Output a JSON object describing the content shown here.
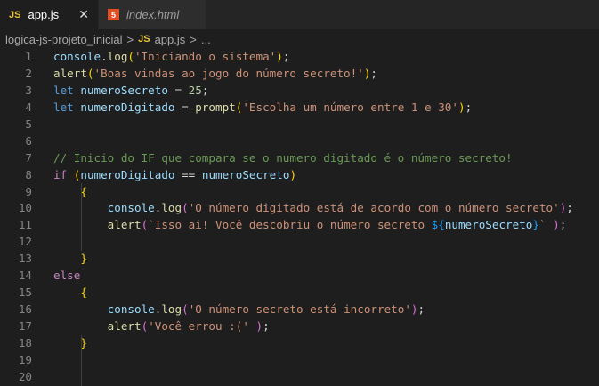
{
  "tabs": [
    {
      "icon": "JS",
      "label": "app.js",
      "close": "✕"
    },
    {
      "icon": "5",
      "label": "index.html"
    }
  ],
  "breadcrumb": {
    "folder": "logica-js-projeto_inicial",
    "sep": ">",
    "icon": "JS",
    "file": "app.js",
    "more": "..."
  },
  "lines": [
    [
      [
        "console",
        "var"
      ],
      [
        ".",
        "p"
      ],
      [
        "log",
        "fn"
      ],
      [
        "(",
        "b1"
      ],
      [
        "'Iniciando o sistema'",
        "str"
      ],
      [
        ")",
        "b1"
      ],
      [
        ";",
        "p"
      ]
    ],
    [
      [
        "alert",
        "fn"
      ],
      [
        "(",
        "b1"
      ],
      [
        "'Boas vindas ao jogo do número secreto!'",
        "str"
      ],
      [
        ")",
        "b1"
      ],
      [
        ";",
        "p"
      ]
    ],
    [
      [
        "let",
        "kw"
      ],
      [
        " ",
        "p"
      ],
      [
        "numeroSecreto",
        "var"
      ],
      [
        " = ",
        "p"
      ],
      [
        "25",
        "num"
      ],
      [
        ";",
        "p"
      ]
    ],
    [
      [
        "let",
        "kw"
      ],
      [
        " ",
        "p"
      ],
      [
        "numeroDigitado",
        "var"
      ],
      [
        " = ",
        "p"
      ],
      [
        "prompt",
        "fn"
      ],
      [
        "(",
        "b1"
      ],
      [
        "'Escolha um número entre 1 e 30'",
        "str"
      ],
      [
        ")",
        "b1"
      ],
      [
        ";",
        "p"
      ]
    ],
    [],
    [],
    [
      [
        "// Inicio do IF que compara se o numero digitado é o número secreto!",
        "cm"
      ]
    ],
    [
      [
        "if",
        "ctl"
      ],
      [
        " ",
        "p"
      ],
      [
        "(",
        "b1"
      ],
      [
        "numeroDigitado",
        "var"
      ],
      [
        " == ",
        "p"
      ],
      [
        "numeroSecreto",
        "var"
      ],
      [
        ")",
        "b1"
      ]
    ],
    [
      [
        "    ",
        "p"
      ],
      [
        "{",
        "b1"
      ]
    ],
    [
      [
        "        ",
        "p"
      ],
      [
        "console",
        "var"
      ],
      [
        ".",
        "p"
      ],
      [
        "log",
        "fn"
      ],
      [
        "(",
        "b2"
      ],
      [
        "'O número digitado está de acordo com o número secreto'",
        "str"
      ],
      [
        ")",
        "b2"
      ],
      [
        ";",
        "p"
      ]
    ],
    [
      [
        "        ",
        "p"
      ],
      [
        "alert",
        "fn"
      ],
      [
        "(",
        "b2"
      ],
      [
        "`Isso ai! Você descobriu o número secreto ",
        "str"
      ],
      [
        "${",
        "b3"
      ],
      [
        "numeroSecreto",
        "var"
      ],
      [
        "}",
        "b3"
      ],
      [
        "` ",
        "str"
      ],
      [
        ")",
        "b2"
      ],
      [
        ";",
        "p"
      ]
    ],
    [],
    [
      [
        "    ",
        "p"
      ],
      [
        "}",
        "b1"
      ]
    ],
    [
      [
        "else",
        "ctl"
      ]
    ],
    [
      [
        "    ",
        "p"
      ],
      [
        "{",
        "b1"
      ]
    ],
    [
      [
        "        ",
        "p"
      ],
      [
        "console",
        "var"
      ],
      [
        ".",
        "p"
      ],
      [
        "log",
        "fn"
      ],
      [
        "(",
        "b2"
      ],
      [
        "'O número secreto está incorreto'",
        "str"
      ],
      [
        ")",
        "b2"
      ],
      [
        ";",
        "p"
      ]
    ],
    [
      [
        "        ",
        "p"
      ],
      [
        "alert",
        "fn"
      ],
      [
        "(",
        "b2"
      ],
      [
        "'Você errou :('",
        "str"
      ],
      [
        " ",
        "p"
      ],
      [
        ")",
        "b2"
      ],
      [
        ";",
        "p"
      ]
    ],
    [
      [
        "    ",
        "p"
      ],
      [
        "}",
        "b1"
      ]
    ],
    [],
    []
  ]
}
